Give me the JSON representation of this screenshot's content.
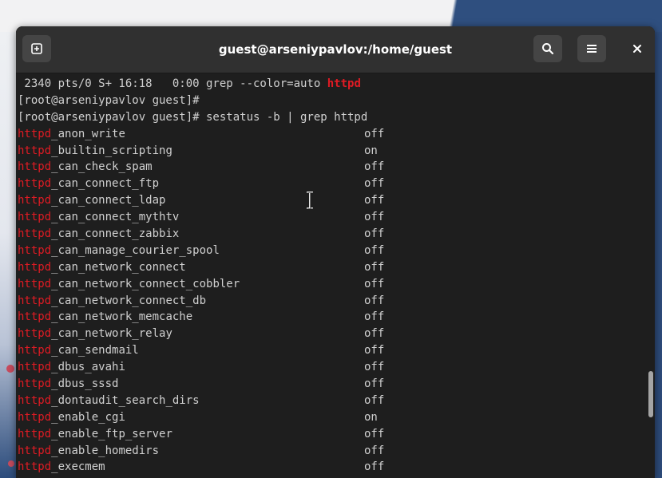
{
  "window": {
    "title": "guest@arseniypavlov:/home/guest"
  },
  "icons": {
    "new_tab": "new-tab-icon",
    "search": "search-icon",
    "menu": "hamburger-menu-icon",
    "close": "close-icon",
    "cursor": "text-cursor-icon"
  },
  "colors": {
    "highlight": "#e01b24",
    "text": "#d0d0d0",
    "background": "#1e1e1e",
    "titlebar": "#303030"
  },
  "terminal": {
    "process_line": {
      "text": " 2340 pts/0 S+ 16:18   0:00 grep --color=auto ",
      "match": "httpd"
    },
    "prompt1": "[root@arseniypavlov guest]#",
    "prompt2": "[root@arseniypavlov guest]# sestatus -b | grep httpd",
    "match_prefix": "httpd",
    "booleans": [
      {
        "name": "_anon_write",
        "value": "off"
      },
      {
        "name": "_builtin_scripting",
        "value": "on"
      },
      {
        "name": "_can_check_spam",
        "value": "off"
      },
      {
        "name": "_can_connect_ftp",
        "value": "off"
      },
      {
        "name": "_can_connect_ldap",
        "value": "off"
      },
      {
        "name": "_can_connect_mythtv",
        "value": "off"
      },
      {
        "name": "_can_connect_zabbix",
        "value": "off"
      },
      {
        "name": "_can_manage_courier_spool",
        "value": "off"
      },
      {
        "name": "_can_network_connect",
        "value": "off"
      },
      {
        "name": "_can_network_connect_cobbler",
        "value": "off"
      },
      {
        "name": "_can_network_connect_db",
        "value": "off"
      },
      {
        "name": "_can_network_memcache",
        "value": "off"
      },
      {
        "name": "_can_network_relay",
        "value": "off"
      },
      {
        "name": "_can_sendmail",
        "value": "off"
      },
      {
        "name": "_dbus_avahi",
        "value": "off"
      },
      {
        "name": "_dbus_sssd",
        "value": "off"
      },
      {
        "name": "_dontaudit_search_dirs",
        "value": "off"
      },
      {
        "name": "_enable_cgi",
        "value": "on"
      },
      {
        "name": "_enable_ftp_server",
        "value": "off"
      },
      {
        "name": "_enable_homedirs",
        "value": "off"
      },
      {
        "name": "_execmem",
        "value": "off"
      }
    ]
  }
}
